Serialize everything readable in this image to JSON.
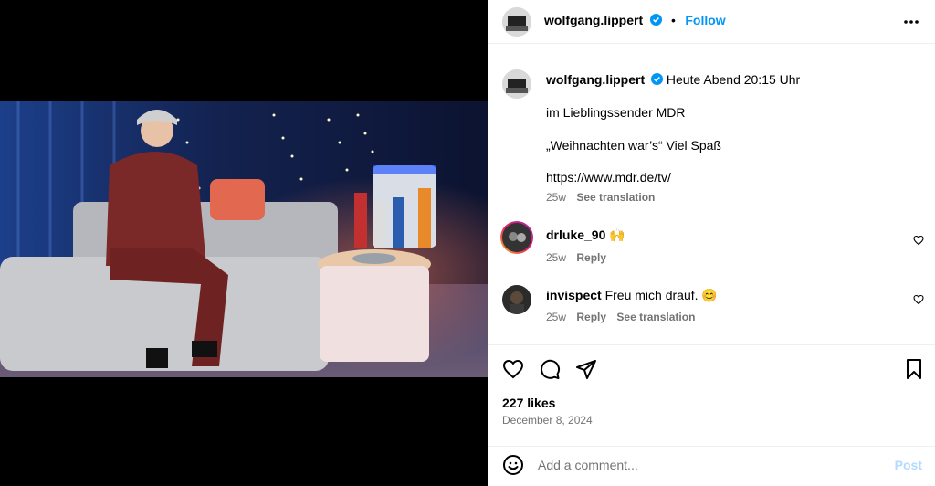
{
  "post": {
    "author": "wolfgang.lippert",
    "follow_label": "Follow",
    "dot": "•",
    "caption": {
      "line1": "Heute Abend 20:15 Uhr",
      "line2": "im Lieblingssender MDR",
      "line3": "„Weihnachten war’s“ Viel Spaß",
      "line4": "https://www.mdr.de/tv/",
      "age": "25w",
      "see_translation": "See translation"
    },
    "comments": [
      {
        "user": "drluke_90",
        "text": "🙌",
        "age": "25w",
        "reply": "Reply"
      },
      {
        "user": "invispect",
        "text": "Freu mich drauf. 😊",
        "age": "25w",
        "reply": "Reply",
        "see_translation": "See translation"
      }
    ],
    "likes": "227 likes",
    "date": "December 8, 2024",
    "add_comment_placeholder": "Add a comment...",
    "post_label": "Post"
  },
  "colors": {
    "link_blue": "#0095f6",
    "post_disabled": "#b3dbff",
    "muted": "#737373",
    "verified": "#0095f6"
  },
  "icons": {
    "more": "more-horizontal-icon",
    "like": "heart-icon",
    "comment": "comment-bubble-icon",
    "share": "paper-plane-icon",
    "save": "bookmark-icon",
    "emoji": "emoji-smile-icon",
    "verified": "verified-badge-icon"
  }
}
